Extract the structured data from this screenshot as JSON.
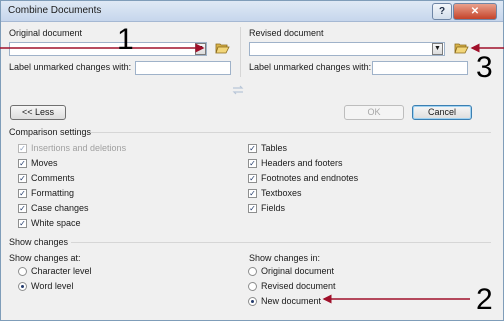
{
  "window": {
    "title": "Combine Documents",
    "help_label": "?",
    "close_label": "✕"
  },
  "original": {
    "label": "Original document",
    "value": "",
    "unmarked_label": "Label unmarked changes with:",
    "unmarked_value": ""
  },
  "revised": {
    "label": "Revised document",
    "value": "",
    "unmarked_label": "Label unmarked changes with:",
    "unmarked_value": ""
  },
  "buttons": {
    "less": "<< Less",
    "ok": "OK",
    "cancel": "Cancel"
  },
  "comparison": {
    "heading": "Comparison settings",
    "left": [
      {
        "label": "Insertions and deletions",
        "checked": true,
        "disabled": true
      },
      {
        "label": "Moves",
        "checked": true,
        "disabled": false
      },
      {
        "label": "Comments",
        "checked": true,
        "disabled": false
      },
      {
        "label": "Formatting",
        "checked": true,
        "disabled": false
      },
      {
        "label": "Case changes",
        "checked": true,
        "disabled": false
      },
      {
        "label": "White space",
        "checked": true,
        "disabled": false
      }
    ],
    "right": [
      {
        "label": "Tables",
        "checked": true
      },
      {
        "label": "Headers and footers",
        "checked": true
      },
      {
        "label": "Footnotes and endnotes",
        "checked": true
      },
      {
        "label": "Textboxes",
        "checked": true
      },
      {
        "label": "Fields",
        "checked": true
      }
    ]
  },
  "show_changes": {
    "heading": "Show changes",
    "at_label": "Show changes at:",
    "at_options": [
      {
        "label": "Character level",
        "selected": false
      },
      {
        "label": "Word level",
        "selected": true
      }
    ],
    "in_label": "Show changes in:",
    "in_options": [
      {
        "label": "Original document",
        "selected": false
      },
      {
        "label": "Revised document",
        "selected": false
      },
      {
        "label": "New document",
        "selected": true
      }
    ]
  },
  "annotations": {
    "step1": "1",
    "step2": "2",
    "step3": "3",
    "arrow_color": "#a0102a"
  },
  "icons": {
    "folder": "folder-open-icon",
    "dropdown": "chevron-down-icon"
  }
}
